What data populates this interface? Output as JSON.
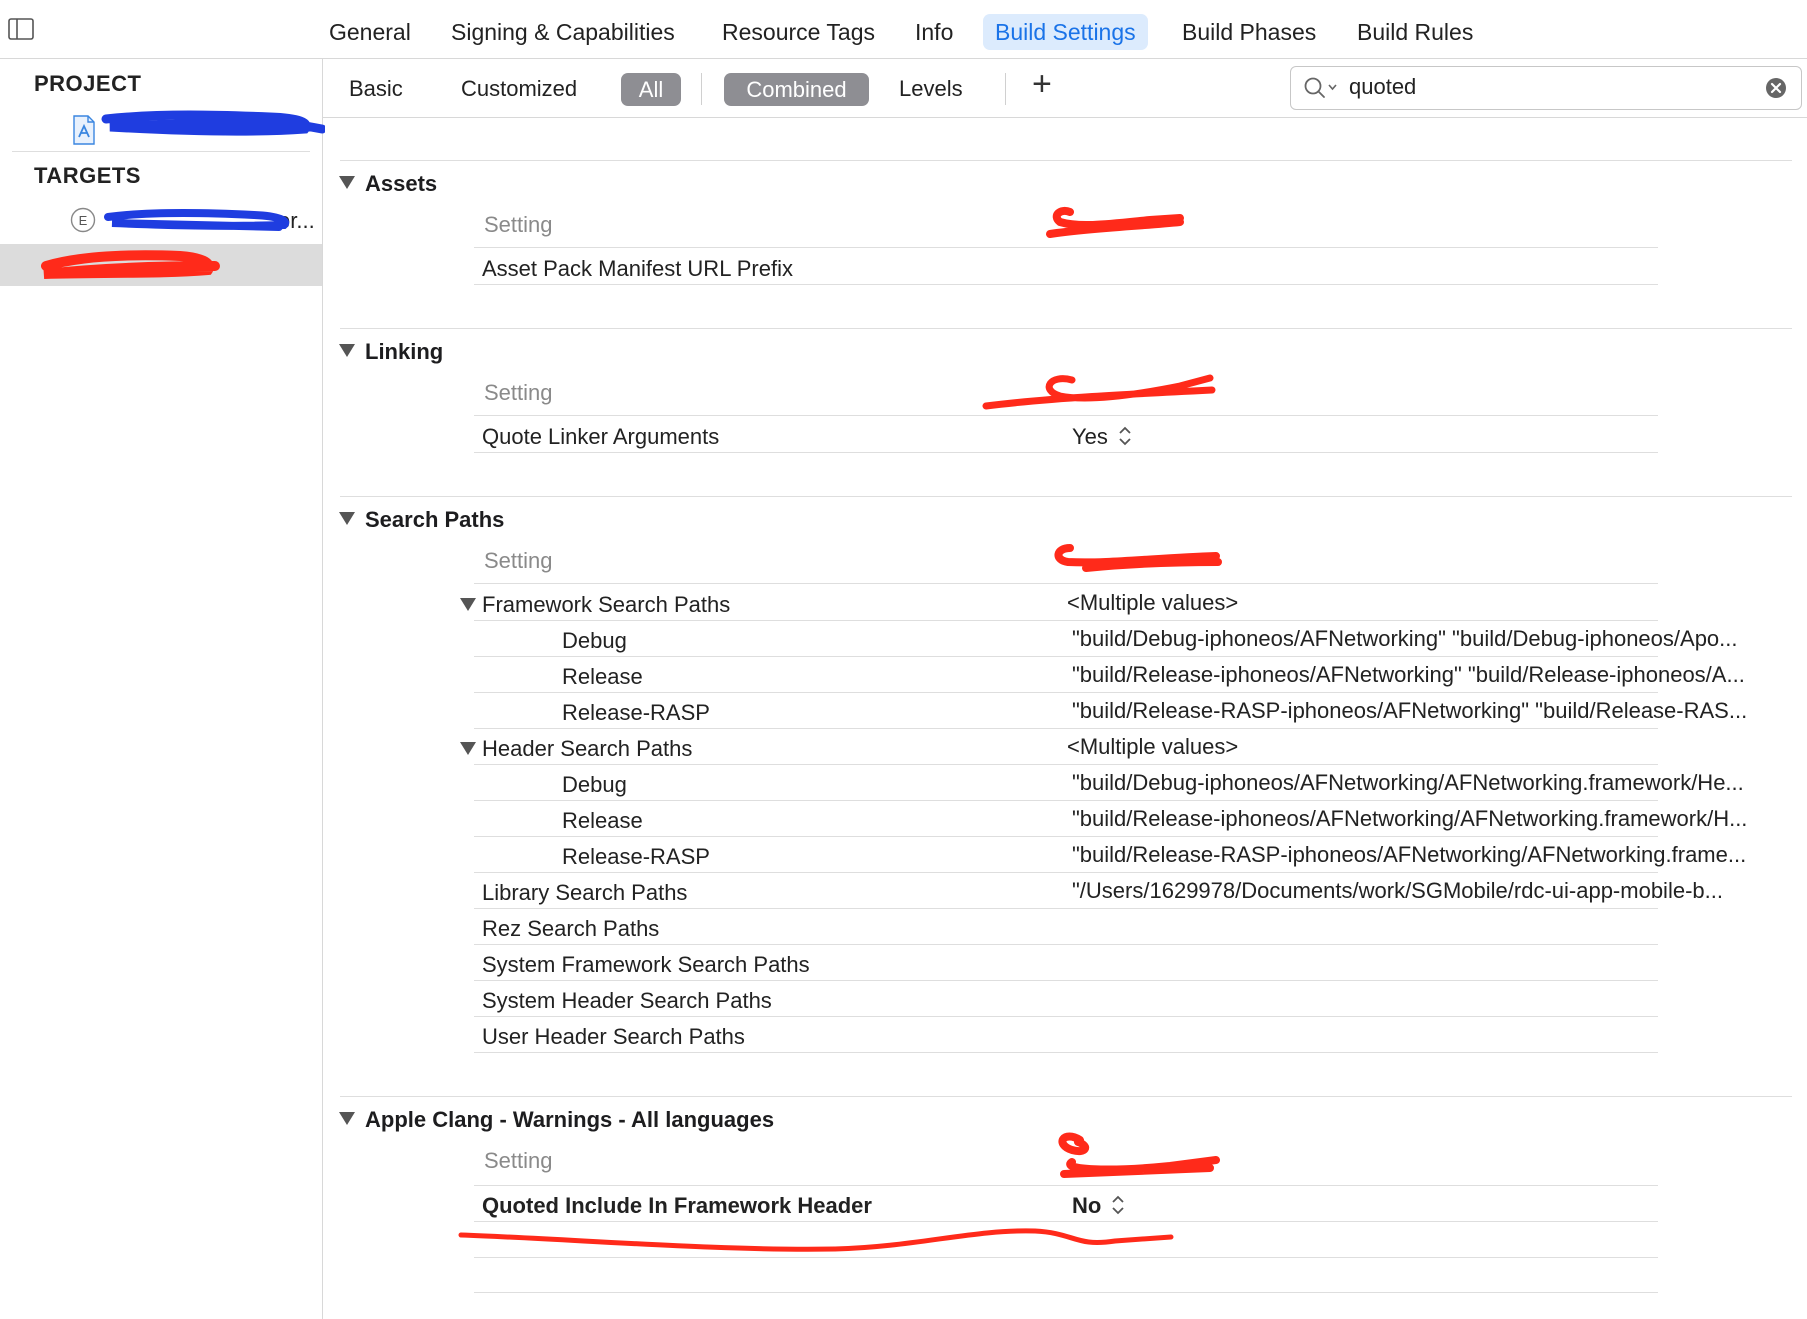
{
  "tabs": [
    {
      "label": "General"
    },
    {
      "label": "Signing & Capabilities"
    },
    {
      "label": "Resource Tags"
    },
    {
      "label": "Info"
    },
    {
      "label": "Build Settings",
      "active": true
    },
    {
      "label": "Build Phases"
    },
    {
      "label": "Build Rules"
    }
  ],
  "sidebar": {
    "project_header": "PROJECT",
    "targets_header": "TARGETS",
    "target_suffix": "er..."
  },
  "filter": {
    "basic": "Basic",
    "customized": "Customized",
    "all": "All",
    "combined": "Combined",
    "levels": "Levels",
    "add_symbol": "+"
  },
  "search": {
    "value": "quoted"
  },
  "sections": {
    "assets": {
      "title": "Assets",
      "column_setting": "Setting",
      "rows": [
        "Asset Pack Manifest URL Prefix"
      ]
    },
    "linking": {
      "title": "Linking",
      "column_setting": "Setting",
      "row_label": "Quote Linker Arguments",
      "row_value": "Yes"
    },
    "search_paths": {
      "title": "Search Paths",
      "column_setting": "Setting",
      "framework": {
        "label": "Framework Search Paths",
        "value": "<Multiple values>",
        "configs": [
          {
            "name": "Debug",
            "value": "\"build/Debug-iphoneos/AFNetworking\" \"build/Debug-iphoneos/Apo..."
          },
          {
            "name": "Release",
            "value": "\"build/Release-iphoneos/AFNetworking\" \"build/Release-iphoneos/A..."
          },
          {
            "name": "Release-RASP",
            "value": "\"build/Release-RASP-iphoneos/AFNetworking\" \"build/Release-RAS..."
          }
        ]
      },
      "header": {
        "label": "Header Search Paths",
        "value": "<Multiple values>",
        "configs": [
          {
            "name": "Debug",
            "value": "\"build/Debug-iphoneos/AFNetworking/AFNetworking.framework/He..."
          },
          {
            "name": "Release",
            "value": "\"build/Release-iphoneos/AFNetworking/AFNetworking.framework/H..."
          },
          {
            "name": "Release-RASP",
            "value": "\"build/Release-RASP-iphoneos/AFNetworking/AFNetworking.frame..."
          }
        ]
      },
      "library": {
        "label": "Library Search Paths",
        "value": "\"/Users/1629978/Documents/work/SGMobile/rdc-ui-app-mobile-b..."
      },
      "others": [
        "Rez Search Paths",
        "System Framework Search Paths",
        "System Header Search Paths",
        "User Header Search Paths"
      ]
    },
    "clang": {
      "title": "Apple Clang - Warnings - All languages",
      "column_setting": "Setting",
      "row_label": "Quoted Include In Framework Header",
      "row_value": "No"
    }
  },
  "colors": {
    "accent": "#1a73e8",
    "active_tab_bg": "#dcebfd",
    "pill_bg": "#8e8e93",
    "scribble_red": "#ff2a1a",
    "scribble_blue": "#1f3de0"
  }
}
